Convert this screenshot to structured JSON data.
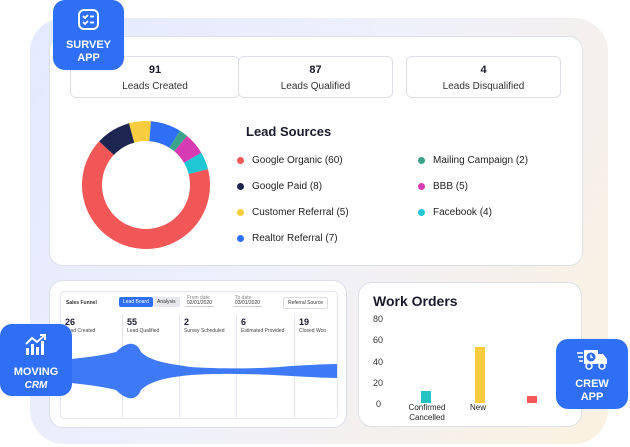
{
  "badges": {
    "survey": {
      "line1": "SURVEY",
      "line2": "APP",
      "icon": "checklist-icon"
    },
    "moving": {
      "line1": "MOVING",
      "line2": "CRM",
      "icon": "trend-chart-icon"
    },
    "crew": {
      "line1": "CREW",
      "line2": "APP",
      "icon": "truck-icon"
    }
  },
  "stats": [
    {
      "value": "91",
      "label": "Leads Created"
    },
    {
      "value": "87",
      "label": "Leads Qualified"
    },
    {
      "value": "4",
      "label": "Leads Disqualified"
    }
  ],
  "lead_sources": {
    "title": "Lead Sources",
    "items": [
      {
        "label": "Google Organic (60)",
        "value": 60,
        "color": "#f25757"
      },
      {
        "label": "Google Paid (8)",
        "value": 8,
        "color": "#1d2550"
      },
      {
        "label": "Customer Referral (5)",
        "value": 5,
        "color": "#f7cd3f"
      },
      {
        "label": "Realtor Referral (7)",
        "value": 7,
        "color": "#2f6ff5"
      },
      {
        "label": "Mailing Campaign (2)",
        "value": 2,
        "color": "#3aa38a"
      },
      {
        "label": "BBB (5)",
        "value": 5,
        "color": "#d63bb4"
      },
      {
        "label": "Facebook (4)",
        "value": 4,
        "color": "#1fc6d4"
      }
    ]
  },
  "funnel": {
    "title": "Sales Funnel",
    "btn_lead_board": "Lead Board",
    "btn_analysis": "Analysis",
    "from_label": "From date",
    "from_value": "02/01/2020",
    "to_label": "To date",
    "to_value": "03/01/2020",
    "source_label": "Referral Source",
    "stages": [
      {
        "count": "26",
        "label": "Lead Created"
      },
      {
        "count": "55",
        "label": "Lead Qualified"
      },
      {
        "count": "2",
        "label": "Survey Scheduled"
      },
      {
        "count": "6",
        "label": "Estimated Provided"
      },
      {
        "count": "19",
        "label": "Closed Won"
      }
    ]
  },
  "work_orders": {
    "title": "Work Orders",
    "chart_data": {
      "type": "bar",
      "categories": [
        "Confirmed",
        "New",
        "Cancelled"
      ],
      "x_tick_labels": [
        "Confirmed\nCancelled",
        "New",
        ""
      ],
      "values": [
        12,
        54,
        7
      ],
      "colors": [
        "#24c4c4",
        "#f7cd3f",
        "#f25757"
      ],
      "yticks": [
        "80",
        "60",
        "40",
        "20",
        "0"
      ],
      "ylim": [
        0,
        80
      ]
    }
  }
}
